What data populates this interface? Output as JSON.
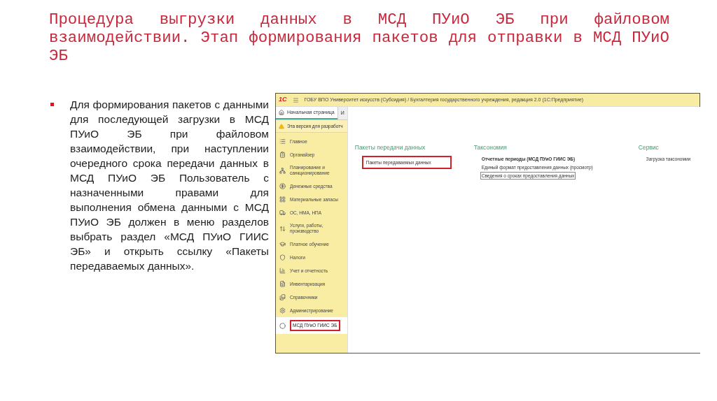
{
  "slide": {
    "title": "Процедура выгрузки данных в МСД ПУиО ЭБ при файловом взаимодействии. Этап формирования пакетов для отправки в МСД ПУиО ЭБ",
    "bullets": [
      "Для формирования пакетов с данными для последующей загрузки в МСД ПУиО ЭБ при файловом взаимодействии, при наступлении очередного срока передачи данных в МСД ПУиО ЭБ Пользователь с назначенными правами для выполнения обмена данными с МСД ПУиО ЭБ должен в меню разделов выбрать раздел «МСД ПУиО ГИИС ЭБ» и открыть ссылку «Пакеты передаваемых данных»."
    ]
  },
  "window": {
    "logo": "1С",
    "title": "ГОБУ ВПО Университет искусств (Субсидия) / Бухгалтерия государственного учреждения, редакция 2.0  (1С:Предприятие)",
    "tabs": [
      {
        "label": "Начальная страница",
        "selected": true
      },
      {
        "label": "И",
        "selected": false
      }
    ],
    "warning": "Эта версия для разработч",
    "sidebar": {
      "items": [
        {
          "label": "Главное",
          "selected": false,
          "highlighted": false
        },
        {
          "label": "Органайзер",
          "selected": false,
          "highlighted": false
        },
        {
          "label": "Планирование и санкционирование",
          "selected": false,
          "highlighted": false
        },
        {
          "label": "Денежные средства",
          "selected": false,
          "highlighted": false
        },
        {
          "label": "Материальные запасы",
          "selected": false,
          "highlighted": false
        },
        {
          "label": "ОС, НМА, НПА",
          "selected": false,
          "highlighted": false
        },
        {
          "label": "Услуги, работы, производство",
          "selected": false,
          "highlighted": false
        },
        {
          "label": "Платное обучение",
          "selected": false,
          "highlighted": false
        },
        {
          "label": "Налоги",
          "selected": false,
          "highlighted": false
        },
        {
          "label": "Учет и отчетность",
          "selected": false,
          "highlighted": false
        },
        {
          "label": "Инвентаризация",
          "selected": false,
          "highlighted": false
        },
        {
          "label": "Справочники",
          "selected": false,
          "highlighted": false
        },
        {
          "label": "Администрирование",
          "selected": false,
          "highlighted": false
        },
        {
          "label": "МСД ПУиО ГИИС ЭБ",
          "selected": true,
          "highlighted": true
        }
      ]
    },
    "sections": [
      {
        "title": "Пакеты передачи данных",
        "links": [
          {
            "label": "Пакеты передаваемых данных",
            "kind": "link",
            "highlighted": true,
            "focused": false
          }
        ]
      },
      {
        "title": "Таксономия",
        "links": [
          {
            "label": "Отчетные периоды (МСД ПУиО ГИИС ЭБ)",
            "kind": "bold",
            "highlighted": false,
            "focused": false
          },
          {
            "label": "Единый формат предоставления данных (просмотр)",
            "kind": "link",
            "highlighted": false,
            "focused": false
          },
          {
            "label": "Сведения о сроках предоставления данных",
            "kind": "link",
            "highlighted": false,
            "focused": true
          }
        ]
      },
      {
        "title": "Сервис",
        "links": [
          {
            "label": "Загрузка таксономии",
            "kind": "link",
            "highlighted": false,
            "focused": false
          }
        ]
      }
    ]
  }
}
